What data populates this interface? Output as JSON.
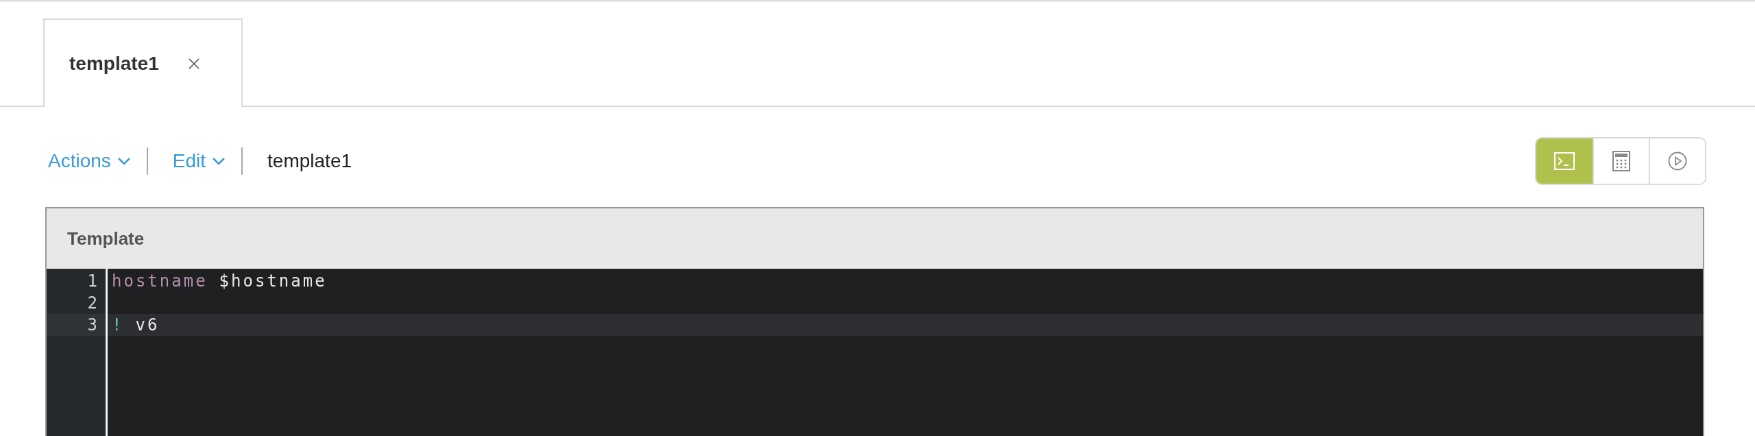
{
  "tabs": [
    {
      "label": "template1",
      "selected": true
    }
  ],
  "toolbar": {
    "menus": [
      {
        "label": "Actions"
      },
      {
        "label": "Edit"
      }
    ],
    "title": "template1"
  },
  "view_buttons": [
    {
      "kind": "terminal",
      "selected": true
    },
    {
      "kind": "calculator",
      "selected": false
    },
    {
      "kind": "play",
      "selected": false
    }
  ],
  "panel": {
    "title": "Template",
    "lines": [
      {
        "number": "1",
        "active": false,
        "tokens": [
          {
            "text": "hostname",
            "kind": "keyword"
          },
          {
            "text": "$hostname",
            "kind": "plain"
          }
        ]
      },
      {
        "number": "2",
        "active": false
      },
      {
        "number": "3",
        "active": true,
        "tokens": [
          {
            "text": "!",
            "kind": "comment"
          },
          {
            "text": "v6",
            "kind": "plain"
          }
        ]
      }
    ]
  }
}
